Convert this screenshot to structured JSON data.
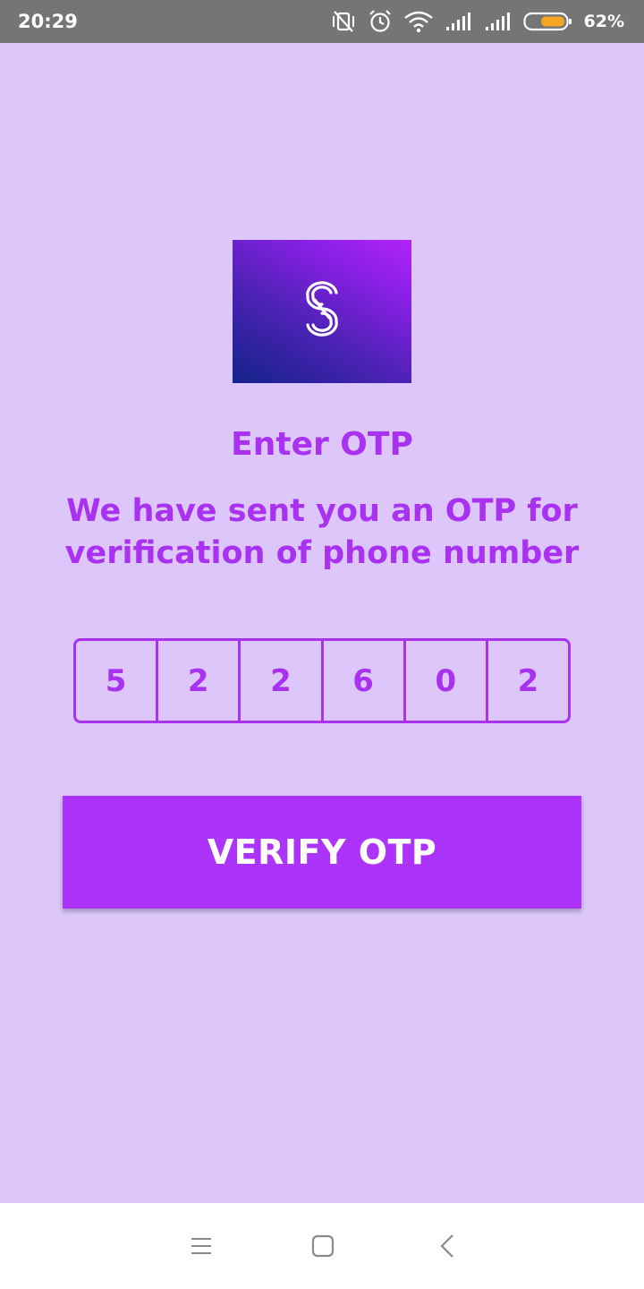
{
  "status_bar": {
    "time": "20:29",
    "battery_percent": "62%",
    "icons": [
      "vibrate-off-icon",
      "alarm-icon",
      "wifi-icon",
      "signal-1-icon",
      "signal-2-icon",
      "battery-icon"
    ],
    "battery_color": "#f5a623"
  },
  "logo": {
    "icon": "s-swirl-logo-icon"
  },
  "heading": {
    "title": "Enter OTP",
    "subtitle_line1": "We have sent you an OTP for",
    "subtitle_line2": "verification of phone number"
  },
  "otp": {
    "digits": [
      "5",
      "2",
      "2",
      "6",
      "0",
      "2"
    ]
  },
  "verify_button": {
    "label": "VERIFY OTP"
  },
  "nav_bar": {
    "icons": [
      "menu-icon",
      "home-square-icon",
      "back-chevron-icon"
    ]
  },
  "colors": {
    "background": "#dcc6fa",
    "accent": "#a932f0",
    "button": "#ab33fa",
    "status_bar": "#757575"
  }
}
